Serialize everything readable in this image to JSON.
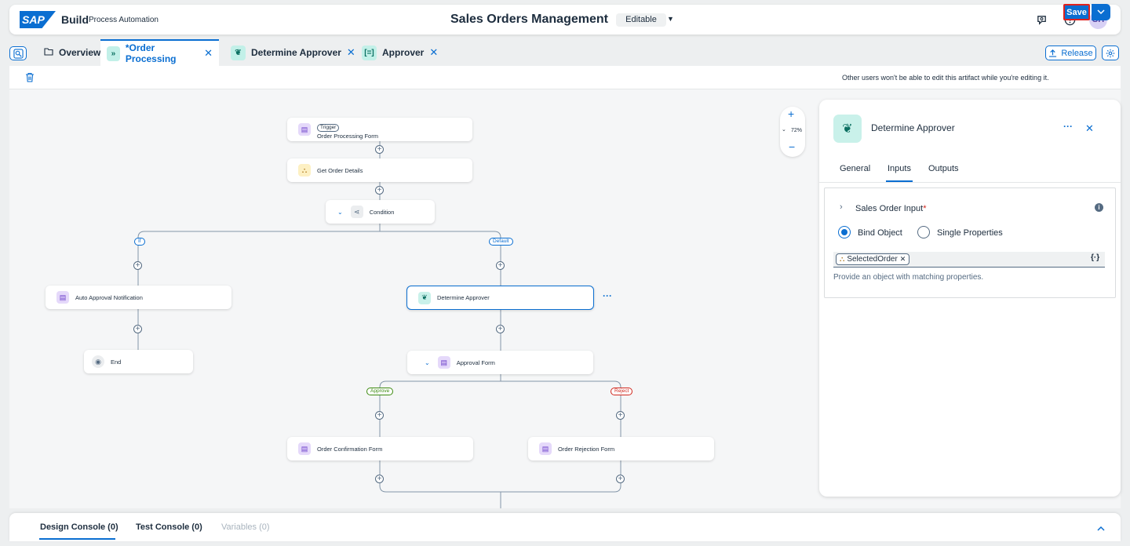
{
  "shell": {
    "logo": "SAP",
    "product": "Build",
    "subproduct": "Process Automation",
    "project_title": "Sales Orders Management",
    "status": "Editable",
    "avatar": "SH"
  },
  "tabs": [
    {
      "label": "Overview"
    },
    {
      "label": "*Order Processing"
    },
    {
      "label": "Determine Approver"
    },
    {
      "label": "Approver"
    }
  ],
  "release_label": "Release",
  "toolbar": {
    "note": "Other users won't be able to edit this artifact while you're editing it.",
    "save_label": "Save"
  },
  "canvas": {
    "zoom": "72%",
    "nodes": {
      "trigger_badge": "Trigger",
      "trigger": "Order Processing Form",
      "get_order": "Get Order Details",
      "condition": "Condition",
      "auto_approval": "Auto Approval Notification",
      "end": "End",
      "determine": "Determine Approver",
      "approval_form": "Approval Form",
      "confirmation": "Order Confirmation Form",
      "rejection": "Order Rejection Form"
    },
    "branches": {
      "if": "If",
      "default": "Default",
      "approve": "Approve",
      "reject": "Reject"
    },
    "colors": {
      "approve": "#3c8a0f",
      "reject": "#d0271d",
      "link": "#0a6ed1"
    }
  },
  "panel": {
    "title": "Determine Approver",
    "tabs": [
      "General",
      "Inputs",
      "Outputs"
    ],
    "active_tab": "Inputs",
    "section_title": "Sales Order Input",
    "required_mark": "*",
    "radio_bind": "Bind Object",
    "radio_single": "Single Properties",
    "token": "SelectedOrder",
    "hint": "Provide an object with matching properties."
  },
  "console": {
    "tabs": [
      "Design Console (0)",
      "Test Console (0)",
      "Variables (0)"
    ]
  }
}
